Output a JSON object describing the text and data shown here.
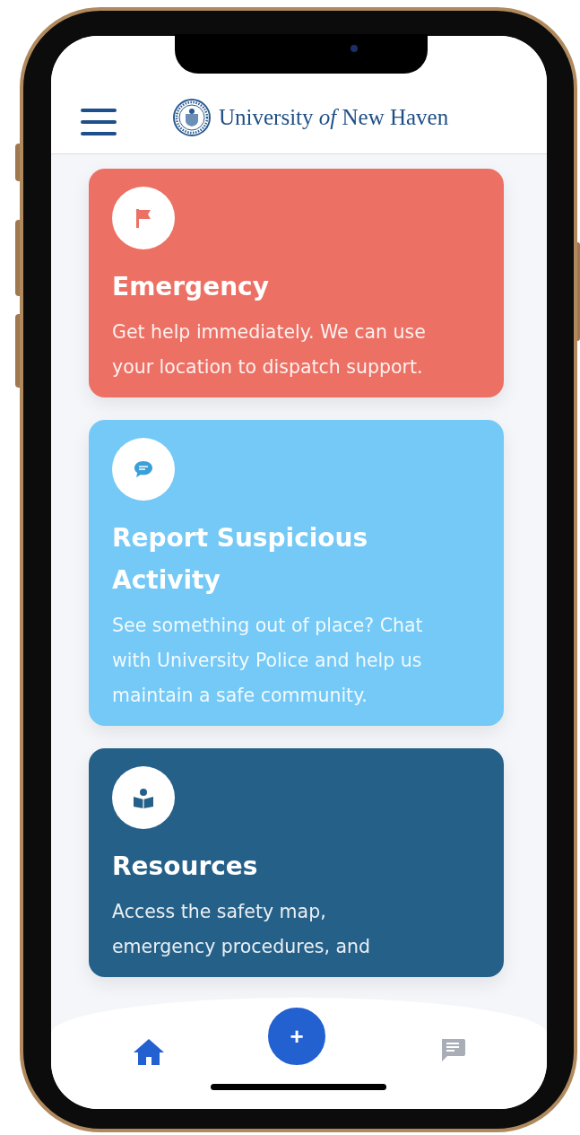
{
  "header": {
    "brand": "University *of* New Haven"
  },
  "cards": [
    {
      "kind": "flag",
      "color": "#ec7064",
      "title": "Emergency",
      "lines": [
        "Get help immediately. We can use",
        "your location to dispatch support."
      ]
    },
    {
      "kind": "chat",
      "color": "#74c9f6",
      "title": "Report Suspicious Activity",
      "lines": [
        "See something out of place? Chat",
        "with University Police and help us",
        "maintain a safe community."
      ]
    },
    {
      "kind": "book",
      "color": "#256089",
      "title": "Resources",
      "lines": [
        "Access the safety map,",
        "emergency procedures, and"
      ]
    }
  ],
  "fab": {
    "label": "+"
  },
  "nav": [
    {
      "kind": "home",
      "selected": true
    },
    {
      "kind": "chat",
      "selected": false
    }
  ]
}
